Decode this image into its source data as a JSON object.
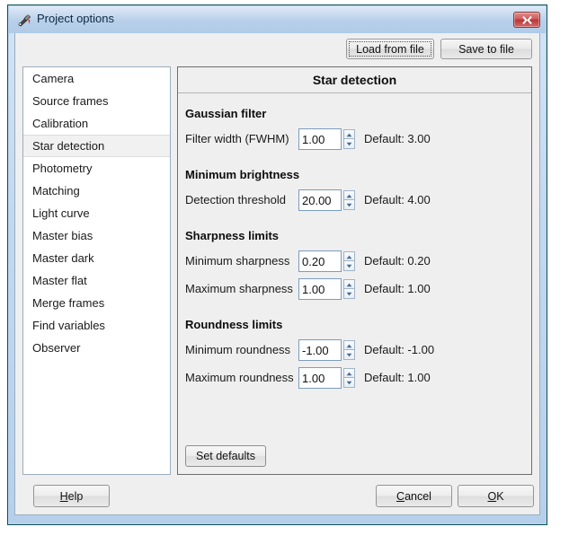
{
  "window": {
    "title": "Project options",
    "icon": "app-star-tool-icon",
    "close_label": "x",
    "accent_border": "#0d4f52",
    "titlebar_color": "#b8cfe9"
  },
  "toolbar": {
    "load_label": "Load from file",
    "save_label": "Save to file"
  },
  "sidebar": {
    "selected": "Star detection",
    "items": [
      {
        "label": "Camera"
      },
      {
        "label": "Source frames"
      },
      {
        "label": "Calibration"
      },
      {
        "label": "Star detection"
      },
      {
        "label": "Photometry"
      },
      {
        "label": "Matching"
      },
      {
        "label": "Light curve"
      },
      {
        "label": "Master bias"
      },
      {
        "label": "Master dark"
      },
      {
        "label": "Master flat"
      },
      {
        "label": "Merge frames"
      },
      {
        "label": "Find variables"
      },
      {
        "label": "Observer"
      }
    ]
  },
  "panel": {
    "header": "Star detection",
    "groups": [
      {
        "title": "Gaussian filter",
        "fields": [
          {
            "label": "Filter width (FWHM)",
            "value": "1.00",
            "default": "Default: 3.00"
          }
        ]
      },
      {
        "title": "Minimum brightness",
        "fields": [
          {
            "label": "Detection threshold",
            "value": "20.00",
            "default": "Default: 4.00"
          }
        ]
      },
      {
        "title": "Sharpness limits",
        "fields": [
          {
            "label": "Minimum sharpness",
            "value": "0.20",
            "default": "Default: 0.20"
          },
          {
            "label": "Maximum sharpness",
            "value": "1.00",
            "default": "Default: 1.00"
          }
        ]
      },
      {
        "title": "Roundness limits",
        "fields": [
          {
            "label": "Minimum roundness",
            "value": "-1.00",
            "default": "Default: -1.00"
          },
          {
            "label": "Maximum roundness",
            "value": "1.00",
            "default": "Default: 1.00"
          }
        ]
      }
    ],
    "set_defaults_label": "Set defaults"
  },
  "bottom_bar": {
    "help": {
      "prefix": "",
      "mnemonic": "H",
      "suffix": "elp"
    },
    "cancel": {
      "prefix": "",
      "mnemonic": "C",
      "suffix": "ancel"
    },
    "ok": {
      "prefix": "",
      "mnemonic": "O",
      "suffix": "K"
    }
  }
}
